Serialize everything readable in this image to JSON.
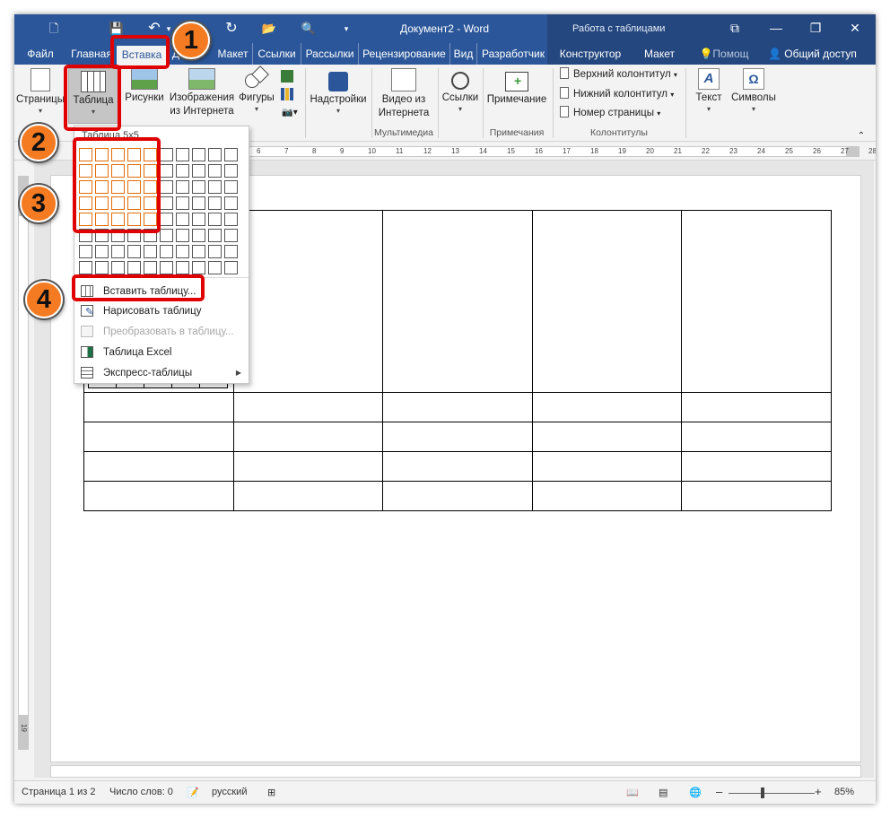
{
  "window": {
    "doc_title": "Документ2 - Word",
    "context_title": "Работа с таблицами",
    "minimize": "—",
    "restore": "❐",
    "close": "✕",
    "ribbon_toggle": "⧉"
  },
  "quick_access": {
    "new": "🗋",
    "save": "💾",
    "undo": "↶",
    "undo_more": "▾",
    "redo": "↻",
    "open": "📂",
    "preview": "🔍",
    "customize": "▾"
  },
  "tabs": [
    {
      "label": "Файл"
    },
    {
      "label": "Главная"
    },
    {
      "label": "Вставка"
    },
    {
      "label": "Д"
    },
    {
      "label": "Макет"
    },
    {
      "label": "Ссылки"
    },
    {
      "label": "Рассылки"
    },
    {
      "label": "Рецензирование"
    },
    {
      "label": "Вид"
    },
    {
      "label": "Разработчик"
    },
    {
      "label": "Конструктор"
    },
    {
      "label": "Макет"
    },
    {
      "label": "Помощ"
    }
  ],
  "share": {
    "label": "Общий доступ"
  },
  "ribbon": {
    "pages": "Страницы",
    "table": "Таблица",
    "pictures": "Рисунки",
    "online_pictures_1": "Изображения",
    "online_pictures_2": "из Интернета",
    "shapes": "Фигуры",
    "addins": "Надстройки",
    "video_1": "Видео из",
    "video_2": "Интернета",
    "links": "Ссылки",
    "comment": "Примечание",
    "header": "Верхний колонтитул",
    "footer": "Нижний колонтитул",
    "page_number": "Номер страницы",
    "text": "Текст",
    "symbols": "Символы",
    "groups": {
      "media": "Мультимедиа",
      "comments": "Примечания",
      "header_footer": "Колонтитулы"
    }
  },
  "ruler": {
    "marks": [
      "6",
      "7",
      "8",
      "9",
      "10",
      "11",
      "12",
      "13",
      "14",
      "15",
      "16",
      "17",
      "18",
      "19",
      "20",
      "21",
      "22",
      "23",
      "24",
      "25",
      "26",
      "27",
      "28"
    ],
    "vmarks": [
      "19"
    ]
  },
  "dropdown": {
    "grid_label": "Таблица 5x5",
    "grid_cols": 10,
    "grid_rows": 8,
    "selected_cols": 5,
    "selected_rows": 5,
    "items": [
      {
        "label": "Вставить таблицу...",
        "enabled": true
      },
      {
        "label": "Нарисовать таблицу",
        "enabled": true
      },
      {
        "label": "Преобразовать в таблицу...",
        "enabled": false
      },
      {
        "label": "Таблица Excel",
        "enabled": true
      },
      {
        "label": "Экспресс-таблицы",
        "enabled": true
      }
    ]
  },
  "annotations": [
    "1",
    "2",
    "3",
    "4"
  ],
  "status": {
    "page": "Страница 1 из 2",
    "words": "Число слов: 0",
    "language": "русский",
    "zoom": "85%",
    "zoom_minus": "–",
    "zoom_plus": "+"
  },
  "colors": {
    "accent": "#2b579a",
    "callout_red": "#e00000",
    "badge_orange": "#f47b22",
    "grid_selected": "#e36c0a"
  }
}
